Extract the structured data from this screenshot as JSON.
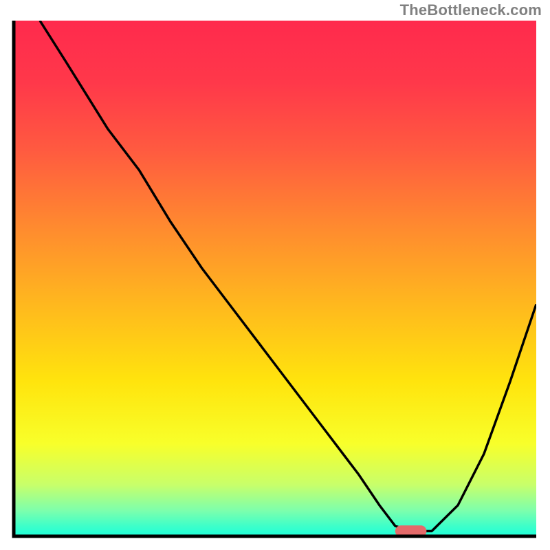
{
  "watermark": "TheBottleneck.com",
  "chart_data": {
    "type": "line",
    "title": "",
    "xlabel": "",
    "ylabel": "",
    "xlim": [
      0,
      100
    ],
    "ylim": [
      0,
      100
    ],
    "axes_visible": false,
    "background_gradient_stops": [
      {
        "offset": 0.0,
        "color": "#ff2a4d"
      },
      {
        "offset": 0.12,
        "color": "#ff384a"
      },
      {
        "offset": 0.25,
        "color": "#ff5a40"
      },
      {
        "offset": 0.4,
        "color": "#ff8a2f"
      },
      {
        "offset": 0.55,
        "color": "#ffb81e"
      },
      {
        "offset": 0.7,
        "color": "#ffe40d"
      },
      {
        "offset": 0.82,
        "color": "#f8ff2a"
      },
      {
        "offset": 0.9,
        "color": "#c8ff6a"
      },
      {
        "offset": 0.95,
        "color": "#7dffac"
      },
      {
        "offset": 0.98,
        "color": "#3effc9"
      },
      {
        "offset": 1.0,
        "color": "#1effda"
      }
    ],
    "series": [
      {
        "name": "bottleneck-curve",
        "color": "#000000",
        "x": [
          5,
          10,
          18,
          24,
          30,
          36,
          42,
          48,
          54,
          60,
          66,
          70,
          73,
          76,
          80,
          85,
          90,
          95,
          100
        ],
        "y": [
          100,
          92,
          79,
          71,
          61,
          52,
          44,
          36,
          28,
          20,
          12,
          6,
          2,
          1,
          1,
          6,
          16,
          30,
          45
        ]
      }
    ],
    "marker": {
      "name": "optimal-range-marker",
      "shape": "capsule",
      "x_center": 76,
      "y": 1,
      "width": 6,
      "height": 2.2,
      "fill": "#e46a6a"
    },
    "plot_border_color": "#000000",
    "plot_border_width": 4
  }
}
